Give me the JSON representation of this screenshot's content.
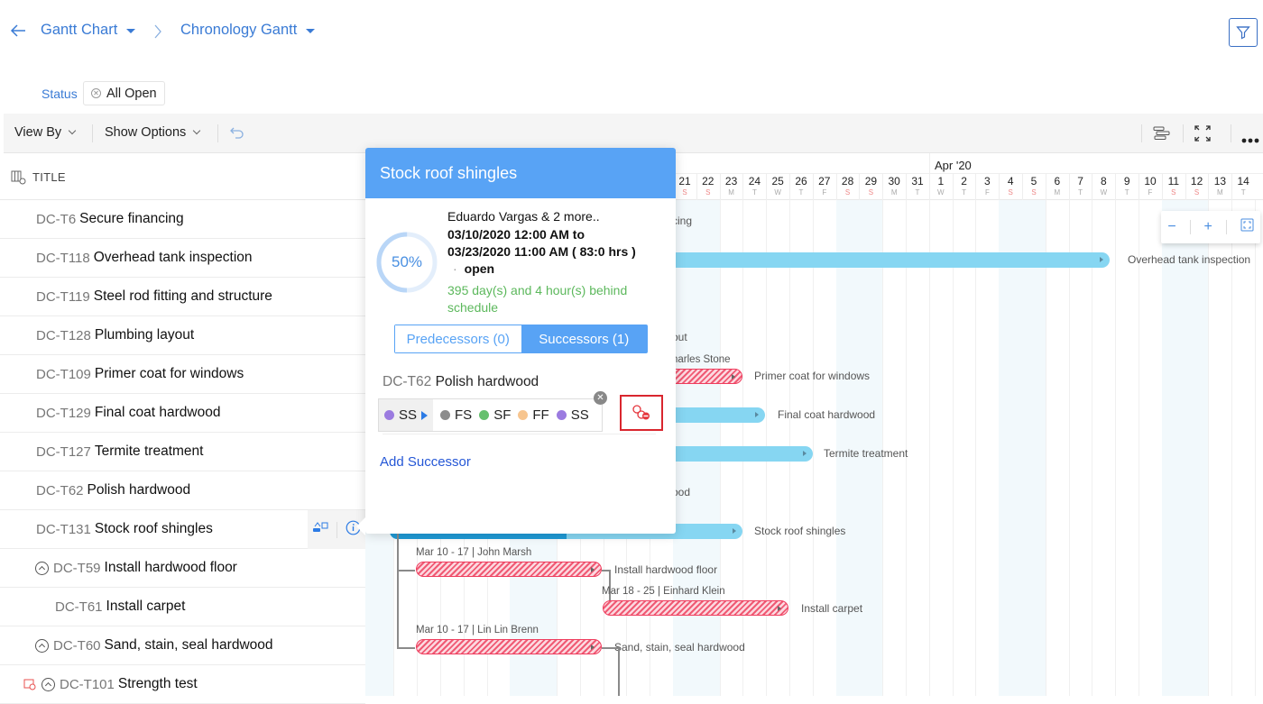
{
  "breadcrumb": {
    "back_icon": "arrow-left-icon",
    "items": [
      {
        "label": "Gantt Chart"
      },
      {
        "label": "Chronology Gantt"
      }
    ],
    "separator_icon": "chevron-right-icon"
  },
  "filter_button": {
    "icon": "funnel-filter-icon"
  },
  "status_filter": {
    "label": "Status",
    "chip": "All Open"
  },
  "toolbar": {
    "view_by": "View By",
    "show_options": "Show Options",
    "undo_icon": "undo-icon",
    "right_icons": [
      "critical-path-icon",
      "fullscreen-icon",
      "more-icon"
    ]
  },
  "grid": {
    "title_header": "TITLE",
    "rows": [
      {
        "id": "DC-T6",
        "name": "Secure financing",
        "indent": 0,
        "collapsible": false
      },
      {
        "id": "DC-T118",
        "name": "Overhead tank inspection",
        "indent": 0,
        "collapsible": false
      },
      {
        "id": "DC-T119",
        "name": "Steel rod fitting and structure",
        "indent": 0,
        "collapsible": false
      },
      {
        "id": "DC-T128",
        "name": "Plumbing layout",
        "indent": 0,
        "collapsible": false
      },
      {
        "id": "DC-T109",
        "name": "Primer coat for windows",
        "indent": 0,
        "collapsible": false
      },
      {
        "id": "DC-T129",
        "name": "Final coat hardwood",
        "indent": 0,
        "collapsible": false
      },
      {
        "id": "DC-T127",
        "name": "Termite treatment",
        "indent": 0,
        "collapsible": false
      },
      {
        "id": "DC-T62",
        "name": "Polish hardwood",
        "indent": 0,
        "collapsible": false
      },
      {
        "id": "DC-T131",
        "name": "Stock roof shingles",
        "indent": 0,
        "collapsible": false,
        "hovered": true
      },
      {
        "id": "DC-T59",
        "name": "Install hardwood floor",
        "indent": 0,
        "collapsible": true
      },
      {
        "id": "DC-T61",
        "name": "Install carpet",
        "indent": 1,
        "collapsible": false
      },
      {
        "id": "DC-T60",
        "name": "Sand, stain, seal hardwood",
        "indent": 0,
        "collapsible": true
      },
      {
        "id": "DC-T101",
        "name": "Strength test",
        "indent": 0,
        "collapsible": true,
        "overdue_icon": true
      }
    ]
  },
  "timeline": {
    "months": [
      {
        "label": "Apr '20",
        "start_day": "Apr 1"
      }
    ],
    "visible_days": [
      {
        "d": "21",
        "w": "S"
      },
      {
        "d": "22",
        "w": "S"
      },
      {
        "d": "23",
        "w": "M"
      },
      {
        "d": "24",
        "w": "T"
      },
      {
        "d": "25",
        "w": "W"
      },
      {
        "d": "26",
        "w": "T"
      },
      {
        "d": "27",
        "w": "F"
      },
      {
        "d": "28",
        "w": "S"
      },
      {
        "d": "29",
        "w": "S"
      },
      {
        "d": "30",
        "w": "M"
      },
      {
        "d": "31",
        "w": "T"
      },
      {
        "d": "1",
        "w": "W"
      },
      {
        "d": "2",
        "w": "T"
      },
      {
        "d": "3",
        "w": "F"
      },
      {
        "d": "4",
        "w": "S"
      },
      {
        "d": "5",
        "w": "S"
      },
      {
        "d": "6",
        "w": "M"
      },
      {
        "d": "7",
        "w": "T"
      },
      {
        "d": "8",
        "w": "W"
      },
      {
        "d": "9",
        "w": "T"
      },
      {
        "d": "10",
        "w": "F"
      },
      {
        "d": "11",
        "w": "S"
      },
      {
        "d": "12",
        "w": "S"
      },
      {
        "d": "13",
        "w": "M"
      },
      {
        "d": "14",
        "w": "T"
      }
    ],
    "bar_labels": {
      "secure_financing_partial": "cing",
      "overhead": "Overhead tank inspection",
      "plumbing_partial": "out",
      "primer_meta_partial": "harles Stone",
      "primer": "Primer coat for windows",
      "final_coat": "Final coat hardwood",
      "termite": "Termite treatment",
      "polish_partial": "ood",
      "stock": "Stock roof shingles",
      "install_floor_meta": "Mar 10 - 17 | John Marsh",
      "install_floor": "Install hardwood floor",
      "carpet_meta": "Mar 18 - 25 | Einhard Klein",
      "carpet": "Install carpet",
      "sand_meta": "Mar 10 - 17 | Lin Lin Brenn",
      "sand": "Sand, stain, seal hardwood"
    },
    "zoom_controls": {
      "zoom_out": "−",
      "zoom_in": "+",
      "fit_icon": "fit-screen-icon"
    }
  },
  "popover": {
    "title": "Stock roof shingles",
    "progress_percent": 50,
    "progress_label": "50%",
    "owner": "Eduardo Vargas & 2 more..",
    "date_line1": "03/10/2020 12:00 AM to",
    "date_line2": "03/23/2020 11:00 AM ( 83:0 hrs )",
    "status": "open",
    "status_bullet": "·",
    "schedule_note": "395 day(s) and 4 hour(s) behind schedule",
    "tabs": [
      {
        "label": "Predecessors (0)",
        "active": false
      },
      {
        "label": "Successors (1)",
        "active": true
      }
    ],
    "successor": {
      "id": "DC-T62",
      "name": "Polish hardwood"
    },
    "dependency_types": [
      {
        "label": "SS",
        "color": "#9b7be0",
        "selected": true
      },
      {
        "label": "FS",
        "color": "#8c8c8c"
      },
      {
        "label": "SF",
        "color": "#66c06e"
      },
      {
        "label": "FF",
        "color": "#f7c58f"
      },
      {
        "label": "SS",
        "color": "#9b7be0"
      }
    ],
    "add_successor": "Add Successor"
  },
  "colors": {
    "accent": "#58a3f5",
    "link": "#3a7bd5",
    "bar_blue": "#86d6f2",
    "bar_overdue": "#ef3d5e",
    "behind_schedule": "#5cb85c",
    "unlink_highlight": "#d9262e"
  }
}
